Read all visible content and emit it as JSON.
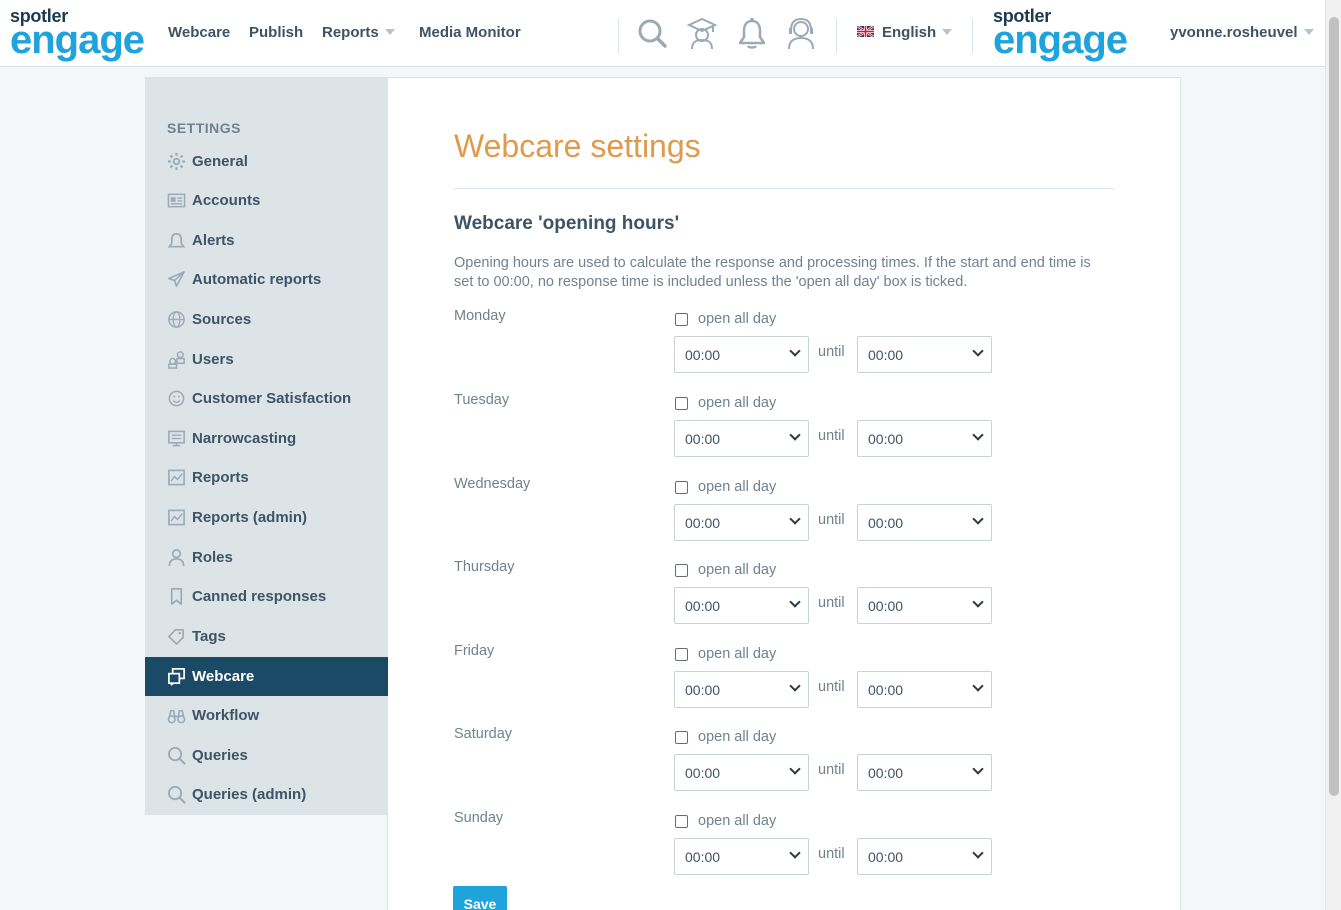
{
  "brand": {
    "top": "spotler",
    "bottom": "engage"
  },
  "nav": [
    {
      "label": "Webcare",
      "dropdown": false
    },
    {
      "label": "Publish",
      "dropdown": false
    },
    {
      "label": "Reports",
      "dropdown": true
    },
    {
      "label": "Media Monitor",
      "dropdown": false
    }
  ],
  "header_icons": [
    "search-icon",
    "graduation-cap-icon",
    "bell-icon",
    "headset-icon"
  ],
  "language": "English",
  "user": "yvonne.rosheuvel",
  "sidebar": {
    "heading": "SETTINGS",
    "items": [
      {
        "label": "General",
        "icon": "gear-icon",
        "active": false
      },
      {
        "label": "Accounts",
        "icon": "id-card-icon",
        "active": false
      },
      {
        "label": "Alerts",
        "icon": "bell-icon",
        "active": false
      },
      {
        "label": "Automatic reports",
        "icon": "paper-plane-icon",
        "active": false
      },
      {
        "label": "Sources",
        "icon": "globe-icon",
        "active": false
      },
      {
        "label": "Users",
        "icon": "users-icon",
        "active": false
      },
      {
        "label": "Customer Satisfaction",
        "icon": "smiley-icon",
        "active": false
      },
      {
        "label": "Narrowcasting",
        "icon": "monitor-icon",
        "active": false
      },
      {
        "label": "Reports",
        "icon": "chart-icon",
        "active": false
      },
      {
        "label": "Reports (admin)",
        "icon": "chart-icon",
        "active": false
      },
      {
        "label": "Roles",
        "icon": "person-icon",
        "active": false
      },
      {
        "label": "Canned responses",
        "icon": "bookmark-icon",
        "active": false
      },
      {
        "label": "Tags",
        "icon": "tag-icon",
        "active": false
      },
      {
        "label": "Webcare",
        "icon": "chat-windows-icon",
        "active": true
      },
      {
        "label": "Workflow",
        "icon": "binoculars-icon",
        "active": false
      },
      {
        "label": "Queries",
        "icon": "magnifier-icon",
        "active": false
      },
      {
        "label": "Queries (admin)",
        "icon": "magnifier-icon",
        "active": false
      }
    ]
  },
  "main": {
    "title": "Webcare settings",
    "section_title": "Webcare 'opening hours'",
    "description": "Opening hours are used to calculate the response and processing times. If the start and end time is set to 00:00, no response time is included unless the 'open all day' box is ticked.",
    "open_all_day_label": "open all day",
    "until_label": "until",
    "days": [
      {
        "name": "Monday",
        "open_all_day": false,
        "start": "00:00",
        "end": "00:00"
      },
      {
        "name": "Tuesday",
        "open_all_day": false,
        "start": "00:00",
        "end": "00:00"
      },
      {
        "name": "Wednesday",
        "open_all_day": false,
        "start": "00:00",
        "end": "00:00"
      },
      {
        "name": "Thursday",
        "open_all_day": false,
        "start": "00:00",
        "end": "00:00"
      },
      {
        "name": "Friday",
        "open_all_day": false,
        "start": "00:00",
        "end": "00:00"
      },
      {
        "name": "Saturday",
        "open_all_day": false,
        "start": "00:00",
        "end": "00:00"
      },
      {
        "name": "Sunday",
        "open_all_day": false,
        "start": "00:00",
        "end": "00:00"
      }
    ],
    "save_label": "Save"
  },
  "colors": {
    "accent_blue": "#1fa3dd",
    "title_orange": "#e09a4c",
    "active_nav": "#1b4a66"
  }
}
